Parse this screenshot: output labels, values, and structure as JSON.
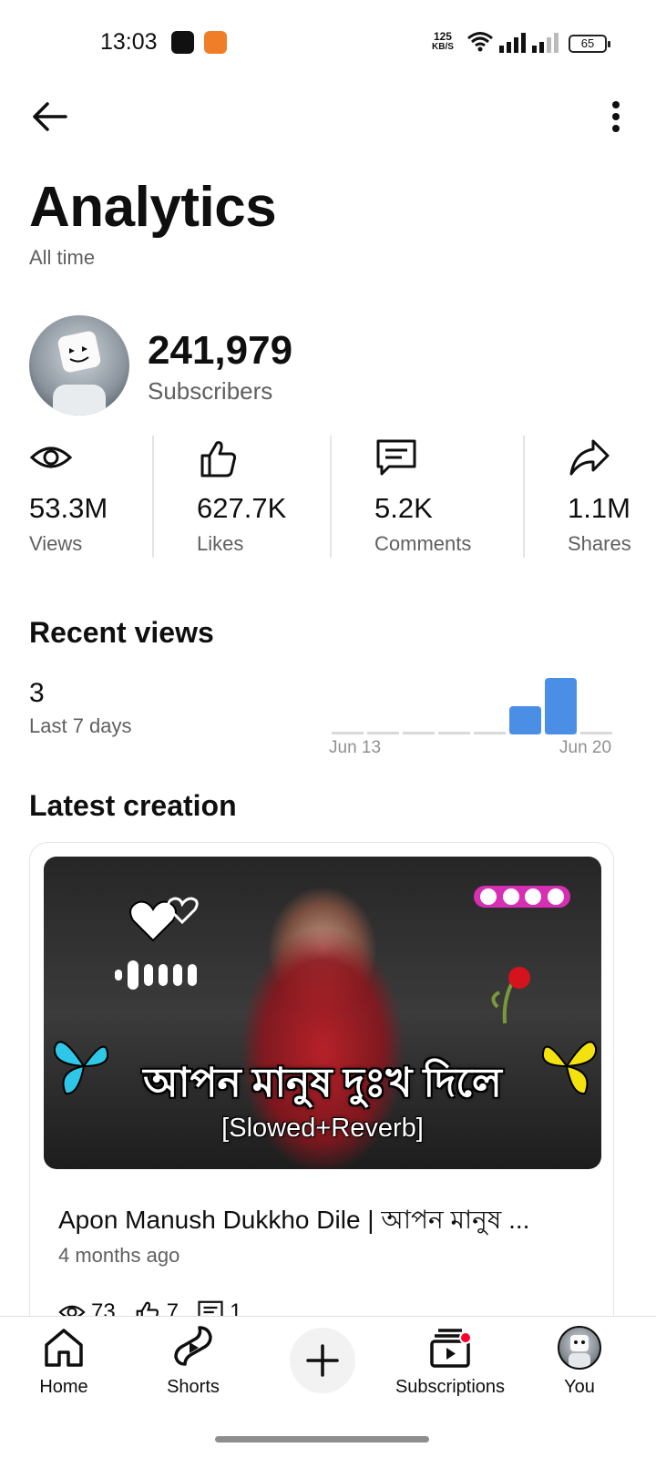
{
  "status_bar": {
    "time": "13:03",
    "speed_top": "125",
    "speed_bottom": "KB/S",
    "battery": "65"
  },
  "header": {
    "back_icon": "arrow-left-icon",
    "more_icon": "more-vert-icon",
    "title": "Analytics",
    "subtitle": "All time"
  },
  "channel": {
    "subscribers_count": "241,979",
    "subscribers_label": "Subscribers"
  },
  "stats": [
    {
      "icon": "eye-icon",
      "value": "53.3M",
      "label": "Views"
    },
    {
      "icon": "thumbs-up-icon",
      "value": "627.7K",
      "label": "Likes"
    },
    {
      "icon": "comment-icon",
      "value": "5.2K",
      "label": "Comments"
    },
    {
      "icon": "share-icon",
      "value": "1.1M",
      "label": "Shares"
    }
  ],
  "recent_views": {
    "title": "Recent views",
    "count": "3",
    "period": "Last 7 days",
    "start_label": "Jun 13",
    "end_label": "Jun 20"
  },
  "chart_data": {
    "type": "bar",
    "categories": [
      "",
      "",
      "",
      "",
      "",
      "",
      "",
      ""
    ],
    "values": [
      0,
      0,
      0,
      0,
      0,
      1,
      2,
      0
    ],
    "tick_labels": [
      "Jun 13",
      "Jun 20"
    ],
    "color": "#4a8ee6",
    "baseline_color": "#d9d9d9"
  },
  "latest_creation": {
    "section_title": "Latest creation",
    "thumbnail_title": "আপন মানুষ দুঃখ দিলে",
    "thumbnail_subtitle": "[Slowed+Reverb]",
    "video_title": "Apon Manush Dukkho Dile | আপন মানুষ ...",
    "age": "4 months ago",
    "views": "73",
    "likes": "7",
    "comments": "1"
  },
  "bottom_nav": {
    "home": "Home",
    "shorts": "Shorts",
    "subscriptions": "Subscriptions",
    "you": "You"
  },
  "colors": {
    "accent_bar": "#4a8ee6",
    "text_primary": "#0f0f0f",
    "text_secondary": "#606060",
    "badge": "#ff0033"
  }
}
